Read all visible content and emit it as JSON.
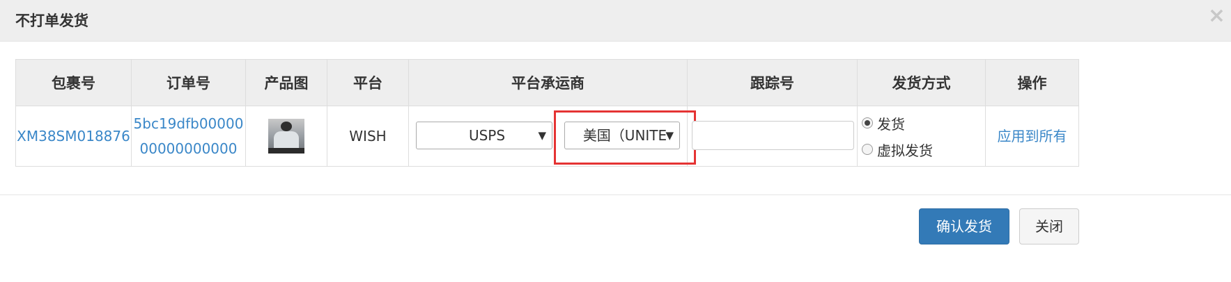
{
  "modal": {
    "title": "不打单发货",
    "close_icon": "×"
  },
  "table": {
    "headers": [
      "包裹号",
      "订单号",
      "产品图",
      "平台",
      "平台承运商",
      "跟踪号",
      "发货方式",
      "操作"
    ],
    "rows": [
      {
        "package_no": "XM38SM018876",
        "order_no": "5bc19dfb0000000000000000",
        "product_image": "product-thumbnail",
        "platform": "WISH",
        "carrier": "USPS",
        "country": "美国（UNITE",
        "tracking_no": "",
        "ship_options": [
          "发货",
          "虚拟发货"
        ],
        "ship_selected": 0,
        "action": "应用到所有"
      }
    ]
  },
  "footer": {
    "confirm_label": "确认发货",
    "close_label": "关闭"
  },
  "colors": {
    "link": "#3a87c8",
    "primary": "#337ab7",
    "highlight": "#e53333"
  }
}
